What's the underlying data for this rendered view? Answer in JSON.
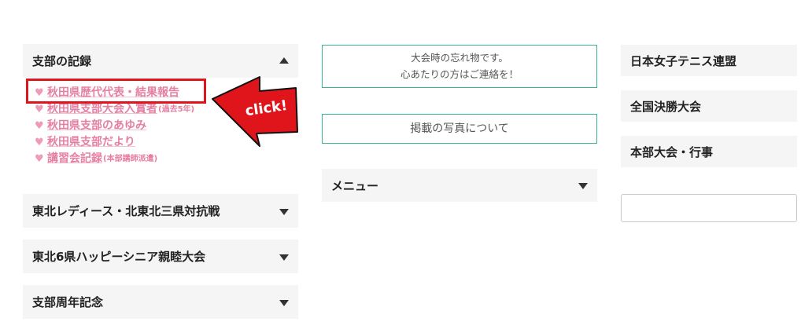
{
  "left_sidebar": {
    "branch_records": {
      "title": "支部の記録",
      "links": [
        {
          "label": "秋田県歴代代表・結果報告",
          "note": ""
        },
        {
          "label": "秋田県支部大会入賞者",
          "note": "(過去5年)"
        },
        {
          "label": "秋田県支部のあゆみ",
          "note": ""
        },
        {
          "label": "秋田県支部だより",
          "note": ""
        },
        {
          "label": "講習会記録",
          "note": "(本部講師派遣)"
        }
      ]
    },
    "sections": [
      {
        "title": "東北レディース・北東北三県対抗戦"
      },
      {
        "title": "東北6県ハッピーシニア親睦大会"
      },
      {
        "title": "支部周年記念"
      }
    ]
  },
  "callout": {
    "text": "click!",
    "color": "#e0151b"
  },
  "middle": {
    "lost_items": {
      "line1": "大会時の忘れ物です。",
      "line2": "心あたりの方はご連絡を！"
    },
    "photos_notice": "掲載の写真について",
    "menu_title": "メニュー"
  },
  "right_sidebar": {
    "items": [
      {
        "label": "日本女子テニス連盟"
      },
      {
        "label": "全国決勝大会"
      },
      {
        "label": "本部大会・行事"
      }
    ],
    "search_value": ""
  },
  "colors": {
    "accent_green": "#38b596",
    "link_pink": "#e67fa3",
    "highlight_red": "#e0151b"
  }
}
